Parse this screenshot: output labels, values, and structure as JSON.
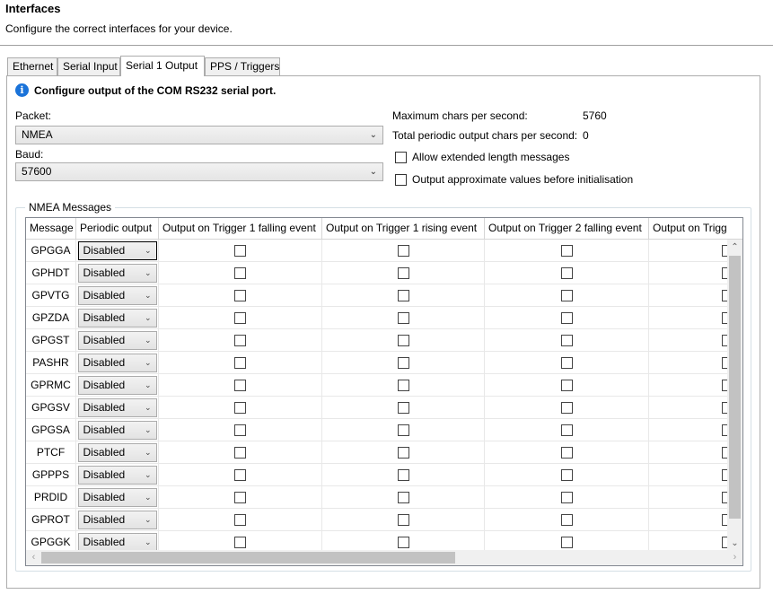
{
  "page": {
    "title": "Interfaces",
    "subtitle": "Configure the correct interfaces for your device."
  },
  "tabs": [
    {
      "label": "Ethernet",
      "active": false
    },
    {
      "label": "Serial Input",
      "active": false
    },
    {
      "label": "Serial 1 Output",
      "active": true
    },
    {
      "label": "PPS / Triggers",
      "active": false
    }
  ],
  "panel": {
    "info_text": "Configure output of the COM RS232 serial port.",
    "packet_label": "Packet:",
    "packet_value": "NMEA",
    "baud_label": "Baud:",
    "baud_value": "57600",
    "max_chars_label": "Maximum chars per second:",
    "max_chars_value": "5760",
    "total_periodic_label": "Total periodic output chars per second:",
    "total_periodic_value": "0",
    "allow_extended_label": "Allow extended length messages",
    "allow_extended_checked": false,
    "output_approx_label": "Output approximate values before initialisation",
    "output_approx_checked": false
  },
  "nmea": {
    "group_label": "NMEA Messages",
    "columns": [
      "Message",
      "Periodic output",
      "Output on Trigger 1 falling event",
      "Output on Trigger 1 rising event",
      "Output on Trigger 2 falling event",
      "Output on Trigg"
    ],
    "rows": [
      {
        "message": "GPGGA",
        "periodic": "Disabled"
      },
      {
        "message": "GPHDT",
        "periodic": "Disabled"
      },
      {
        "message": "GPVTG",
        "periodic": "Disabled"
      },
      {
        "message": "GPZDA",
        "periodic": "Disabled"
      },
      {
        "message": "GPGST",
        "periodic": "Disabled"
      },
      {
        "message": "PASHR",
        "periodic": "Disabled"
      },
      {
        "message": "GPRMC",
        "periodic": "Disabled"
      },
      {
        "message": "GPGSV",
        "periodic": "Disabled"
      },
      {
        "message": "GPGSA",
        "periodic": "Disabled"
      },
      {
        "message": "PTCF",
        "periodic": "Disabled"
      },
      {
        "message": "GPPPS",
        "periodic": "Disabled"
      },
      {
        "message": "PRDID",
        "periodic": "Disabled"
      },
      {
        "message": "GPROT",
        "periodic": "Disabled"
      },
      {
        "message": "GPGGK",
        "periodic": "Disabled"
      }
    ]
  },
  "icons": {
    "info": "info-icon",
    "chevron": "chevron-down-icon",
    "scroll_up": "scroll-up-arrow-icon",
    "scroll_down": "scroll-down-arrow-icon",
    "scroll_left": "scroll-left-arrow-icon",
    "scroll_right": "scroll-right-arrow-icon"
  },
  "colors": {
    "info_blue": "#1a73d9",
    "border": "#acacac"
  }
}
